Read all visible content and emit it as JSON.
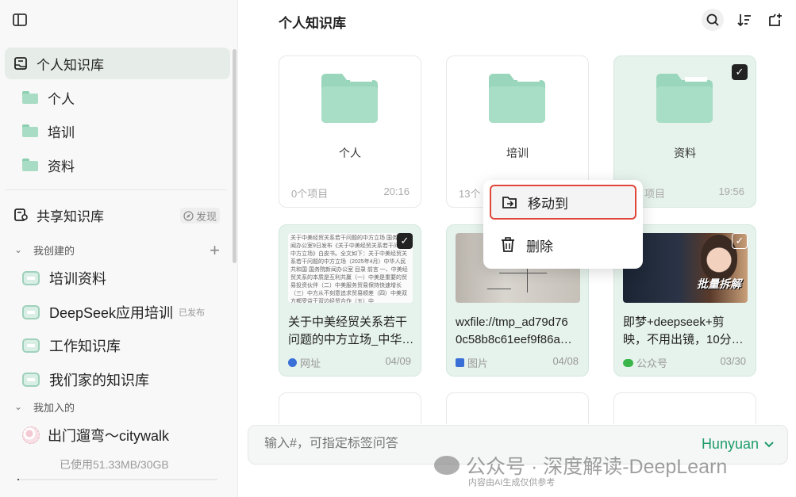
{
  "sidebar": {
    "personal_kb": "个人知识库",
    "folders": [
      "个人",
      "培训",
      "资料"
    ],
    "shared_kb": "共享知识库",
    "discover": "发现",
    "created_section": "我创建的",
    "created_kbs": [
      {
        "name": "培训资料",
        "badge": ""
      },
      {
        "name": "DeepSeek应用培训",
        "badge": "已发布"
      },
      {
        "name": "工作知识库",
        "badge": ""
      },
      {
        "name": "我们家的知识库",
        "badge": ""
      }
    ],
    "joined_section": "我加入的",
    "joined_kbs": [
      {
        "name": "出门遛弯～citywalk"
      }
    ],
    "storage": "已使用51.33MB/30GB"
  },
  "main": {
    "title": "个人知识库",
    "folders": [
      {
        "name": "个人",
        "count": "0个项目",
        "time": "20:16",
        "selected": false
      },
      {
        "name": "培训",
        "count": "13个",
        "time": "",
        "selected": false
      },
      {
        "name": "资料",
        "count": "项目",
        "time": "19:56",
        "selected": true
      }
    ],
    "items": [
      {
        "line1": "关于中美经贸关系若干",
        "line2": "问题的中方立场_中华…",
        "type": "网址",
        "date": "04/09",
        "selected": true,
        "thumb_text": "关于中美经贸关系若干问题的中方立场 国务院新闻办公室9日发布《关于中美经贸关系若干问题的中方立场》白皮书。全文如下：关于中美经贸关系若干问题的中方立场（2025年4月）中华人民共和国 国务院新闻办公室 目录 前言 一、中美经贸关系的本质是互利共赢（一）中美是重要的贸易投资伙伴（二）中美服务贸易保持快速增长（三）中方从不刻意追求贸易顺差（四）中美双方都受益于双边经贸合作（五）中"
      },
      {
        "line1": "wxfile://tmp_ad79d76",
        "line2": "0c58b8c61eef9f86a…",
        "type": "图片",
        "date": "04/08",
        "selected": false
      },
      {
        "line1": "即梦+deepseek+剪",
        "line2": "映，不用出镜，10分…",
        "type": "公众号",
        "date": "03/30",
        "selected": true,
        "thumb_label": "批量拆解"
      }
    ]
  },
  "context_menu": {
    "move": "移动到",
    "delete": "删除"
  },
  "ask": {
    "placeholder": "输入#，可指定标签问答",
    "model": "Hunyuan"
  },
  "watermark": {
    "text": "公众号 · 深度解读-DeepLearn",
    "sub": "内容由AI生成仅供参考"
  }
}
